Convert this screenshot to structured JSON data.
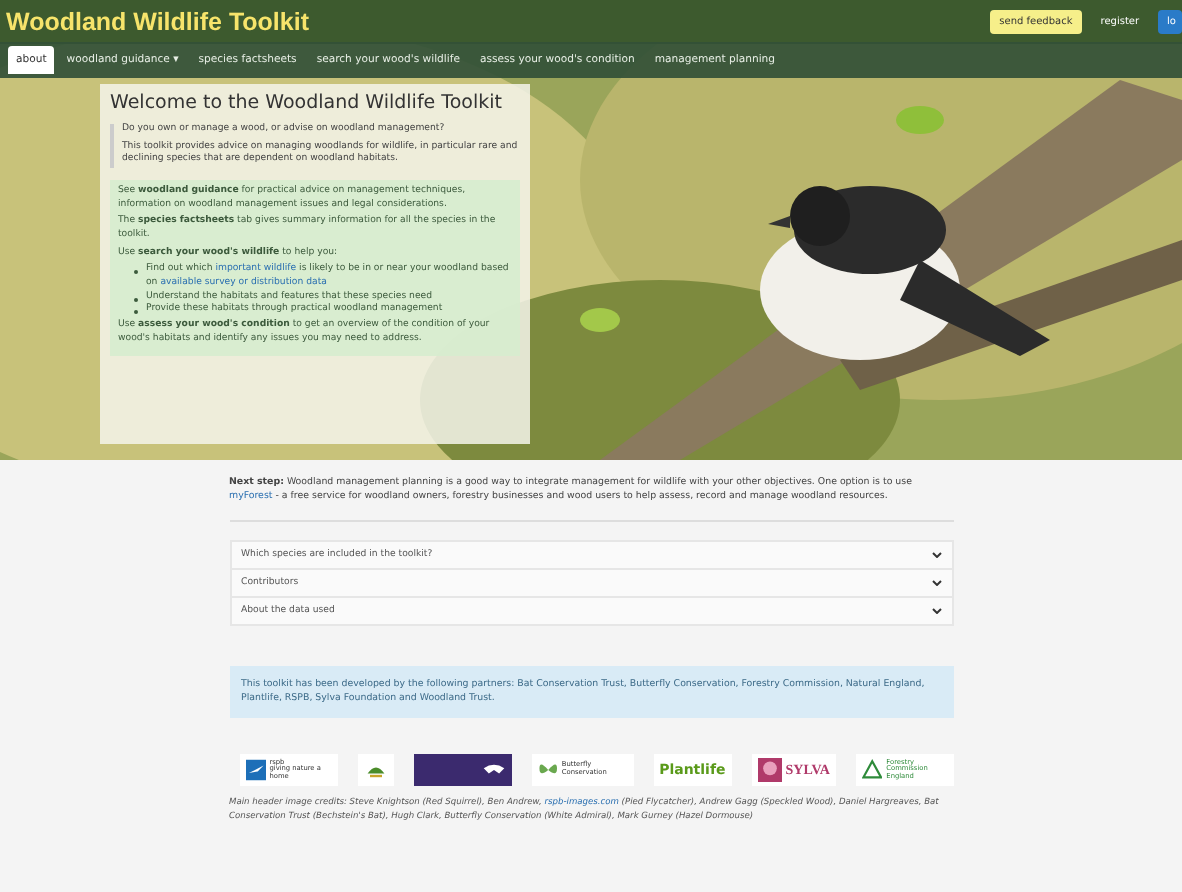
{
  "header": {
    "title": "Woodland Wildlife Toolkit",
    "actions": [
      {
        "label": "send feedback",
        "kind": "feedback"
      },
      {
        "label": "register",
        "kind": "plain"
      },
      {
        "label": "lo",
        "kind": "primary"
      }
    ]
  },
  "nav": [
    {
      "label": "about",
      "selected": true
    },
    {
      "label": "woodland guidance ▾",
      "selected": false
    },
    {
      "label": "species factsheets",
      "selected": false
    },
    {
      "label": "search your wood's wildlife",
      "selected": false
    },
    {
      "label": "assess your wood's condition",
      "selected": false
    },
    {
      "label": "management planning",
      "selected": false
    }
  ],
  "welcome": {
    "title": "Welcome to the Woodland Wildlife Toolkit",
    "intro": [
      "Do you own or manage a wood, or advise on woodland management?",
      "This toolkit provides advice on managing woodlands for wildlife, in particular rare and declining species that are dependent on woodland habitats."
    ],
    "guidance": [
      [
        {
          "t": "See ",
          "kind": "plain"
        },
        {
          "t": "woodland guidance",
          "kind": "bold"
        },
        {
          "t": " for practical advice on management techniques, information on woodland management issues and legal considerations.",
          "kind": "plain"
        }
      ],
      [
        {
          "t": "The ",
          "kind": "plain"
        },
        {
          "t": "species factsheets",
          "kind": "bold"
        },
        {
          "t": " tab gives summary information for all the species in the toolkit.",
          "kind": "plain"
        }
      ],
      [
        {
          "t": "Use ",
          "kind": "plain"
        },
        {
          "t": "search your wood's wildlife",
          "kind": "bold"
        },
        {
          "t": " to help you:",
          "kind": "plain"
        }
      ]
    ],
    "bullets": [
      [
        {
          "t": "Find out which ",
          "kind": "plain"
        },
        {
          "t": "important wildlife",
          "kind": "link"
        },
        {
          "t": " is likely to be in or near your woodland based on ",
          "kind": "plain"
        },
        {
          "t": "available survey or distribution data",
          "kind": "link"
        }
      ],
      [
        {
          "t": "Understand the habitats and features that these species need",
          "kind": "plain"
        }
      ],
      [
        {
          "t": "Provide these habitats through practical woodland management",
          "kind": "plain"
        }
      ]
    ],
    "closing": [
      {
        "t": "Use ",
        "kind": "plain"
      },
      {
        "t": "assess your wood's condition",
        "kind": "bold"
      },
      {
        "t": " to get an overview of the condition of your wood's habitats and identify any issues you may need to address.",
        "kind": "plain"
      }
    ]
  },
  "next_step": [
    {
      "t": "Next step:",
      "kind": "bold"
    },
    {
      "t": " Woodland management planning is a good way to integrate management for wildlife with your other objectives. One option is to use ",
      "kind": "plain"
    },
    {
      "t": "myForest",
      "kind": "link"
    },
    {
      "t": " - a free service for woodland owners, forestry businesses and wood users to help assess, record and manage woodland resources.",
      "kind": "plain"
    }
  ],
  "accordion": [
    {
      "label": "Which species are included in the toolkit?",
      "expanded": false
    },
    {
      "label": "Contributors",
      "expanded": false
    },
    {
      "label": "About the data used",
      "expanded": false
    }
  ],
  "partners_note": "This toolkit has been developed by the following partners: Bat Conservation Trust, Butterfly Conservation, Forestry Commission, Natural England, Plantlife, RSPB, Sylva Foundation and Woodland Trust.",
  "logos": [
    {
      "kind": "rspb",
      "lines": [
        "rspb",
        "giving nature a home"
      ]
    },
    {
      "kind": "natural-england"
    },
    {
      "kind": "bat-trust"
    },
    {
      "kind": "butterfly",
      "lines": [
        "Butterfly Conservation"
      ]
    },
    {
      "kind": "plantlife",
      "lines": [
        "Plantlife"
      ]
    },
    {
      "kind": "sylva",
      "lines": [
        "SYLVA"
      ]
    },
    {
      "kind": "forestry",
      "lines": [
        "Forestry Commission",
        "England"
      ]
    }
  ],
  "credits": [
    {
      "t": "Main header image credits: Steve Knightson (Red Squirrel), Ben Andrew, ",
      "kind": "plain"
    },
    {
      "t": "rspb-images.com",
      "kind": "link"
    },
    {
      "t": " (Pied Flycatcher), Andrew Gagg (Speckled Wood), Daniel Hargreaves, Bat Conservation Trust (Bechstein's Bat), Hugh Clark, Butterfly Conservation (White Admiral), Mark Gurney (Hazel Dormouse)",
      "kind": "plain"
    }
  ]
}
